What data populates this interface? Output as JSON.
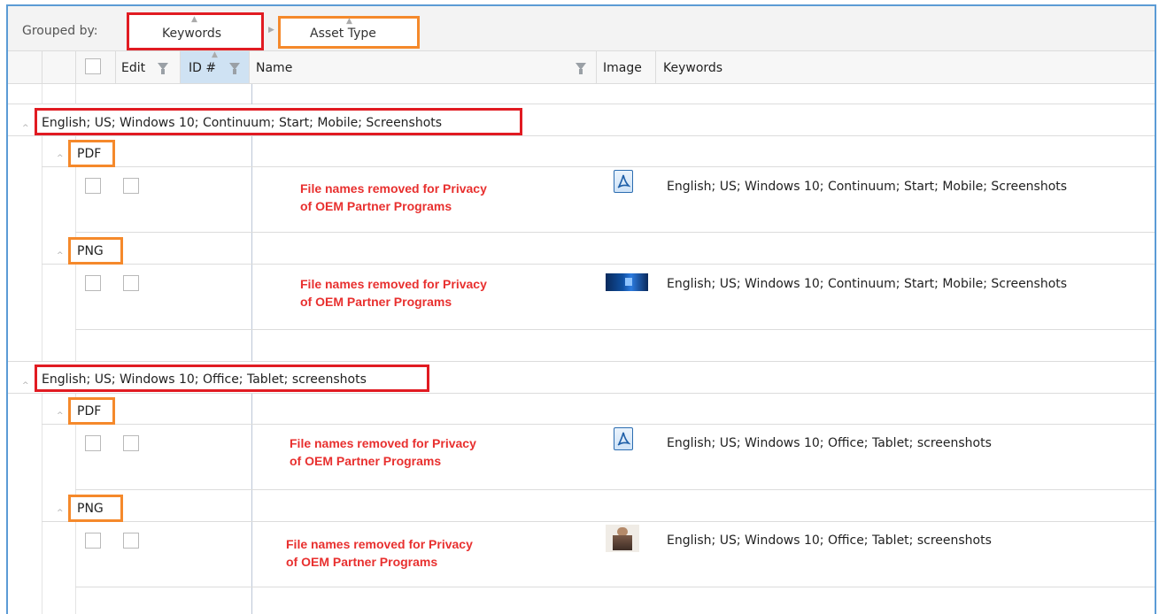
{
  "grouping": {
    "label": "Grouped by:",
    "chips": [
      "Keywords",
      "Asset Type"
    ]
  },
  "columns": {
    "edit": "Edit",
    "id": "ID #",
    "name": "Name",
    "image": "Image",
    "keywords": "Keywords"
  },
  "groups": [
    {
      "keyword": "English; US; Windows 10; Continuum; Start; Mobile; Screenshots",
      "subgroups": [
        {
          "type": "PDF",
          "name_note_1": "File names removed for Privacy",
          "name_note_2": "of OEM Partner Programs",
          "image_icon": "pdf-icon",
          "keywords": "English; US; Windows 10; Continuum; Start; Mobile; Screenshots"
        },
        {
          "type": "PNG",
          "name_note_1": "File names removed for Privacy",
          "name_note_2": "of OEM Partner Programs",
          "image_icon": "windows-screenshot-thumbnail",
          "keywords": "English; US; Windows 10; Continuum; Start; Mobile; Screenshots"
        }
      ]
    },
    {
      "keyword": "English; US; Windows 10; Office; Tablet; screenshots",
      "subgroups": [
        {
          "type": "PDF",
          "name_note_1": "File names removed for Privacy",
          "name_note_2": "of OEM Partner Programs",
          "image_icon": "pdf-icon",
          "keywords": "English; US; Windows 10; Office; Tablet; screenshots"
        },
        {
          "type": "PNG",
          "name_note_1": "File names removed for Privacy",
          "name_note_2": "of OEM Partner Programs",
          "image_icon": "photo-thumbnail",
          "keywords": "English; US; Windows 10; Office; Tablet; screenshots"
        }
      ]
    }
  ],
  "colors": {
    "highlight_red": "#e11b22",
    "highlight_orange": "#f5892b",
    "frame_blue": "#5b9bd5",
    "note_red": "#e8302f"
  }
}
